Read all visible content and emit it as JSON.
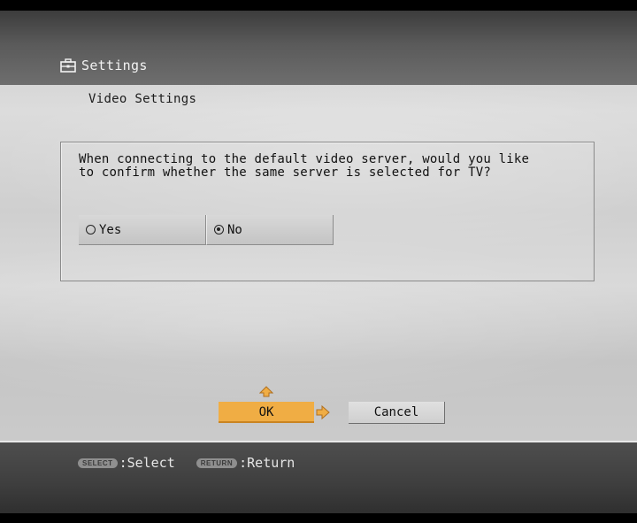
{
  "header": {
    "title": "Settings",
    "icon": "settings-toolbox-icon"
  },
  "subtitle": "Video Settings",
  "dialog": {
    "question_line1": "When connecting to the default video server, would you like",
    "question_line2": "to confirm whether the same server is selected for TV?",
    "options": [
      {
        "label": "Yes",
        "selected": false
      },
      {
        "label": "No",
        "selected": true
      }
    ]
  },
  "buttons": {
    "ok_label": "OK",
    "cancel_label": "Cancel"
  },
  "footer": {
    "select_key": "SELECT",
    "select_label": ":Select",
    "return_key": "RETURN",
    "return_label": ":Return"
  },
  "colors": {
    "focus": "#f0ad44",
    "band": "#4a4a4a"
  }
}
